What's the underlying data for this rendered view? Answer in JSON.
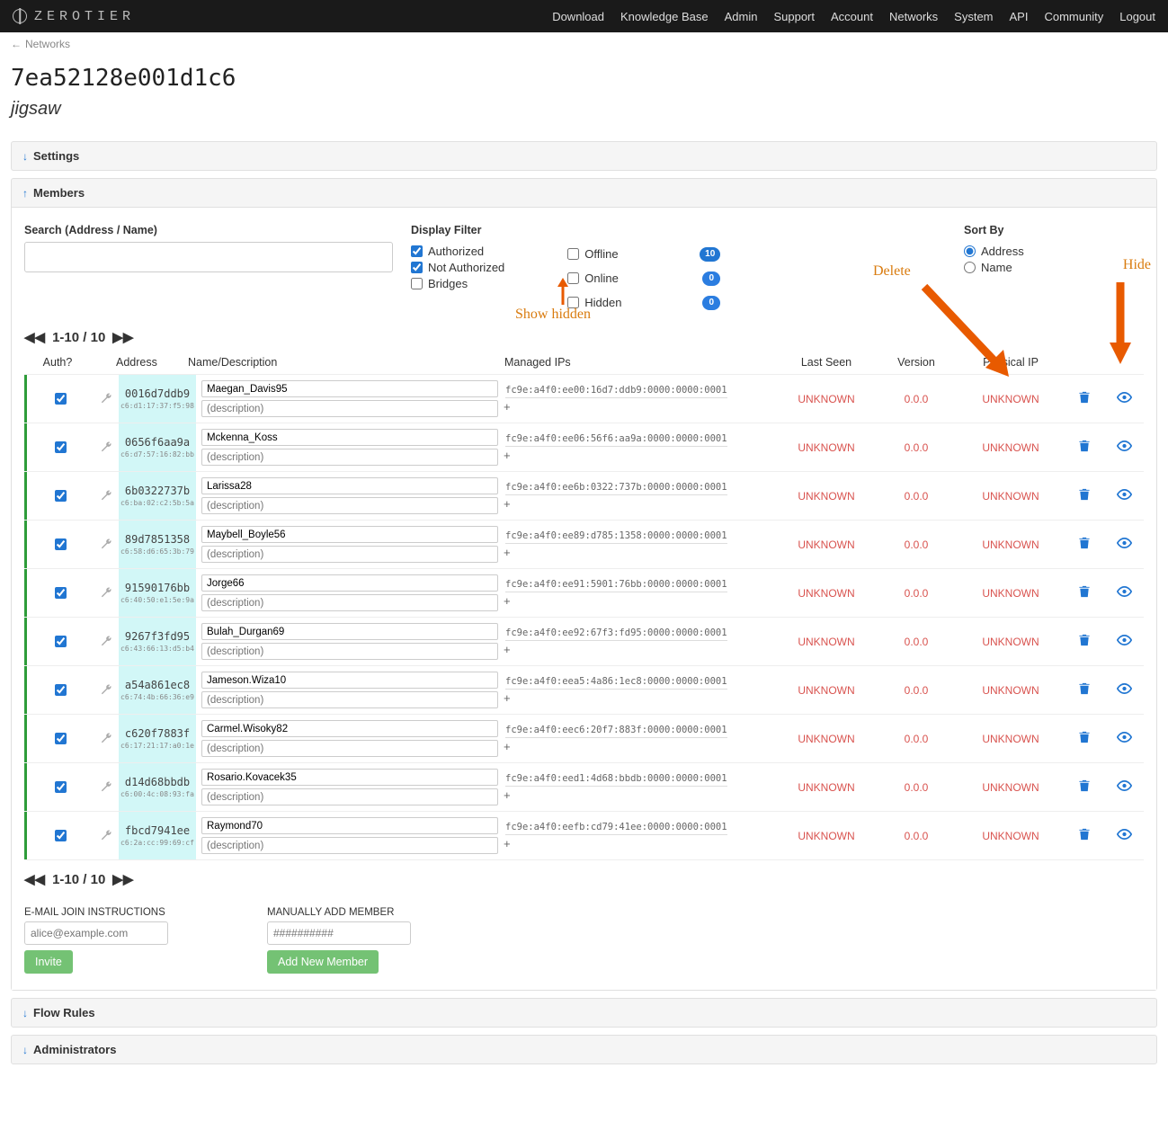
{
  "brand": "ZEROTIER",
  "nav": [
    "Download",
    "Knowledge Base",
    "Admin",
    "Support",
    "Account",
    "Networks",
    "System",
    "API",
    "Community",
    "Logout"
  ],
  "breadcrumb": {
    "back": "Networks"
  },
  "network": {
    "id": "7ea52128e001d1c6",
    "name": "jigsaw"
  },
  "panels": {
    "settings": "Settings",
    "members": "Members",
    "flow": "Flow Rules",
    "admins": "Administrators"
  },
  "search": {
    "label": "Search (Address / Name)",
    "value": ""
  },
  "displayFilter": {
    "label": "Display Filter",
    "left": [
      {
        "label": "Authorized",
        "checked": true
      },
      {
        "label": "Not Authorized",
        "checked": true
      },
      {
        "label": "Bridges",
        "checked": false
      }
    ],
    "right": [
      {
        "label": "Offline",
        "checked": false,
        "count": "10"
      },
      {
        "label": "Online",
        "checked": false,
        "count": "0"
      },
      {
        "label": "Hidden",
        "checked": false,
        "count": "0"
      }
    ]
  },
  "sortBy": {
    "label": "Sort By",
    "options": [
      {
        "label": "Address",
        "checked": true
      },
      {
        "label": "Name",
        "checked": false
      }
    ]
  },
  "pager": "1-10 / 10",
  "columns": {
    "auth": "Auth?",
    "addr": "Address",
    "name": "Name/Description",
    "ips": "Managed IPs",
    "last": "Last Seen",
    "ver": "Version",
    "phys": "Physical IP"
  },
  "descPlaceholder": "(description)",
  "members": [
    {
      "addr": "0016d7ddb9",
      "sub": "c6:d1:17:37:f5:98",
      "name": "Maegan_Davis95",
      "ip": "fc9e:a4f0:ee00:16d7:ddb9:0000:0000:0001",
      "last": "UNKNOWN",
      "ver": "0.0.0",
      "phys": "UNKNOWN"
    },
    {
      "addr": "0656f6aa9a",
      "sub": "c6:d7:57:16:82:bb",
      "name": "Mckenna_Koss",
      "ip": "fc9e:a4f0:ee06:56f6:aa9a:0000:0000:0001",
      "last": "UNKNOWN",
      "ver": "0.0.0",
      "phys": "UNKNOWN"
    },
    {
      "addr": "6b0322737b",
      "sub": "c6:ba:02:c2:5b:5a",
      "name": "Larissa28",
      "ip": "fc9e:a4f0:ee6b:0322:737b:0000:0000:0001",
      "last": "UNKNOWN",
      "ver": "0.0.0",
      "phys": "UNKNOWN"
    },
    {
      "addr": "89d7851358",
      "sub": "c6:58:d6:65:3b:79",
      "name": "Maybell_Boyle56",
      "ip": "fc9e:a4f0:ee89:d785:1358:0000:0000:0001",
      "last": "UNKNOWN",
      "ver": "0.0.0",
      "phys": "UNKNOWN"
    },
    {
      "addr": "91590176bb",
      "sub": "c6:40:50:e1:5e:9a",
      "name": "Jorge66",
      "ip": "fc9e:a4f0:ee91:5901:76bb:0000:0000:0001",
      "last": "UNKNOWN",
      "ver": "0.0.0",
      "phys": "UNKNOWN"
    },
    {
      "addr": "9267f3fd95",
      "sub": "c6:43:66:13:d5:b4",
      "name": "Bulah_Durgan69",
      "ip": "fc9e:a4f0:ee92:67f3:fd95:0000:0000:0001",
      "last": "UNKNOWN",
      "ver": "0.0.0",
      "phys": "UNKNOWN"
    },
    {
      "addr": "a54a861ec8",
      "sub": "c6:74:4b:66:36:e9",
      "name": "Jameson.Wiza10",
      "ip": "fc9e:a4f0:eea5:4a86:1ec8:0000:0000:0001",
      "last": "UNKNOWN",
      "ver": "0.0.0",
      "phys": "UNKNOWN"
    },
    {
      "addr": "c620f7883f",
      "sub": "c6:17:21:17:a0:1e",
      "name": "Carmel.Wisoky82",
      "ip": "fc9e:a4f0:eec6:20f7:883f:0000:0000:0001",
      "last": "UNKNOWN",
      "ver": "0.0.0",
      "phys": "UNKNOWN"
    },
    {
      "addr": "d14d68bbdb",
      "sub": "c6:00:4c:08:93:fa",
      "name": "Rosario.Kovacek35",
      "ip": "fc9e:a4f0:eed1:4d68:bbdb:0000:0000:0001",
      "last": "UNKNOWN",
      "ver": "0.0.0",
      "phys": "UNKNOWN"
    },
    {
      "addr": "fbcd7941ee",
      "sub": "c6:2a:cc:99:69:cf",
      "name": "Raymond70",
      "ip": "fc9e:a4f0:eefb:cd79:41ee:0000:0000:0001",
      "last": "UNKNOWN",
      "ver": "0.0.0",
      "phys": "UNKNOWN"
    }
  ],
  "forms": {
    "email": {
      "label": "E-MAIL JOIN INSTRUCTIONS",
      "placeholder": "alice@example.com",
      "button": "Invite"
    },
    "manual": {
      "label": "MANUALLY ADD MEMBER",
      "placeholder": "##########",
      "button": "Add New Member"
    }
  },
  "annotations": {
    "showHidden": "Show hidden",
    "delete": "Delete",
    "hide": "Hide"
  }
}
